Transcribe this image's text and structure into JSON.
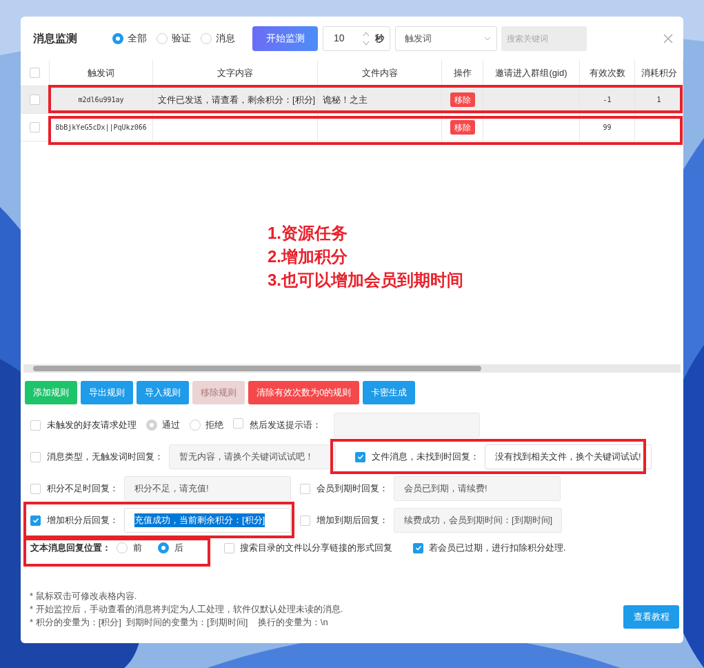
{
  "header": {
    "title": "消息监测",
    "filter_options": [
      {
        "label": "全部",
        "selected": true
      },
      {
        "label": "验证",
        "selected": false
      },
      {
        "label": "消息",
        "selected": false
      }
    ],
    "start_button": "开始监测",
    "interval": {
      "value": "10",
      "unit": "秒"
    },
    "field_select": {
      "value": "触发词"
    },
    "search": {
      "placeholder": "搜索关键词"
    }
  },
  "table": {
    "all_checked": false,
    "columns": [
      "触发词",
      "文字内容",
      "文件内容",
      "操作",
      "邀请进入群组(gid)",
      "有效次数",
      "消耗积分"
    ],
    "rows": [
      {
        "selected": true,
        "checked": false,
        "cells": [
          "m2dl6u991ay",
          "文件已发送，请查看，剩余积分：[积分]",
          "诡秘！之主",
          "移除",
          "",
          "-1",
          "1"
        ]
      },
      {
        "selected": false,
        "checked": false,
        "cells": [
          "8bBjkYeG5cDx||PqUkz066",
          "",
          "",
          "移除",
          "",
          "99",
          ""
        ]
      }
    ]
  },
  "annotation": {
    "lines": [
      "1.资源任务",
      "2.增加积分",
      "3.也可以增加会员到期时间"
    ]
  },
  "buttons": [
    {
      "label": "添加规则",
      "kind": "success",
      "disabled": false
    },
    {
      "label": "导出规则",
      "kind": "primary",
      "disabled": false
    },
    {
      "label": "导入规则",
      "kind": "primary",
      "disabled": false
    },
    {
      "label": "移除规则",
      "kind": "danger",
      "disabled": true
    },
    {
      "label": "清除有效次数为0的规则",
      "kind": "danger",
      "disabled": false
    },
    {
      "label": "卡密生成",
      "kind": "primary",
      "disabled": false
    }
  ],
  "friend_request": {
    "label": "未触发的好友请求处理",
    "checked": false,
    "choices": [
      {
        "label": "通过",
        "selected": true
      },
      {
        "label": "拒绝",
        "selected": false
      }
    ],
    "prompt": {
      "label": "然后发送提示语：",
      "checked": false
    }
  },
  "replies": [
    {
      "label": "消息类型，无触发词时回复：",
      "checked": false,
      "value": "暂无内容，请换个关键词试试吧！",
      "text_selected": false
    },
    {
      "label": "文件消息，未找到时回复：",
      "checked": true,
      "value": "没有找到相关文件，换个关键词试试!",
      "text_selected": false
    },
    {
      "label": "积分不足时回复：",
      "checked": false,
      "value": "积分不足，请充值!",
      "text_selected": false
    },
    {
      "label": "会员到期时回复：",
      "checked": false,
      "value": "会员已到期，请续费!",
      "text_selected": false
    },
    {
      "label": "增加积分后回复：",
      "checked": true,
      "value": "充值成功，当前剩余积分：[积分]",
      "text_selected": true
    },
    {
      "label": "增加到期后回复：",
      "checked": false,
      "value": "续费成功，会员到期时间：[到期时间]",
      "text_selected": false
    }
  ],
  "reply_position": {
    "label": "文本消息回复位置：",
    "choices": [
      {
        "label": "前",
        "selected": false
      },
      {
        "label": "后",
        "selected": true
      }
    ]
  },
  "extra_options": [
    {
      "label": "搜索目录的文件以分享链接的形式回复",
      "checked": false
    },
    {
      "label": "若会员已过期，进行扣除积分处理.",
      "checked": true
    }
  ],
  "notes": [
    "* 鼠标双击可修改表格内容.",
    "* 开始监控后，手动查看的消息将判定为人工处理，软件仅默认处理未读的消息.",
    "* 积分的变量为：[积分]  到期时间的变量为：[到期时间]    换行的变量为：\\n"
  ],
  "tutorial_button": "查看教程"
}
